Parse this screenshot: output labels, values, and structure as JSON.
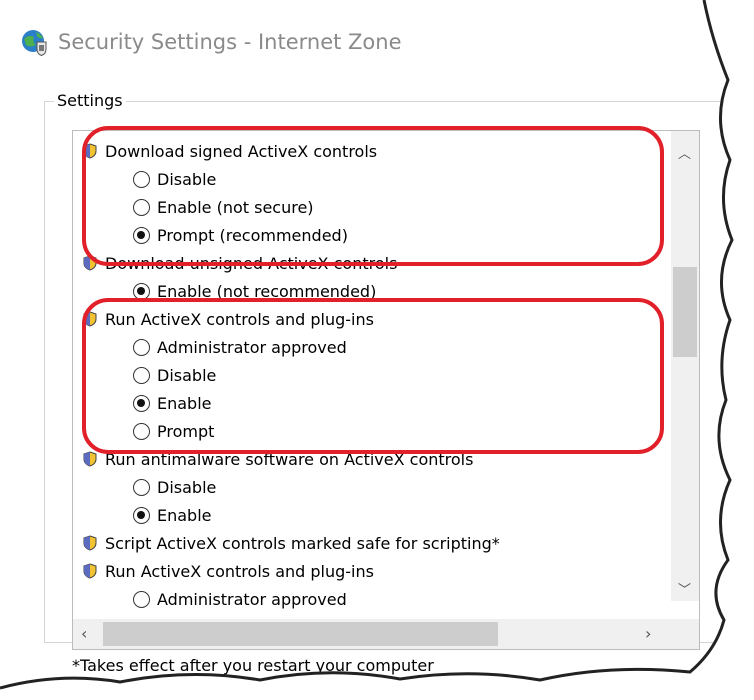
{
  "dialog": {
    "title": "Security Settings - Internet Zone",
    "icon": "globe-shield-icon",
    "group_label": "Settings",
    "footnote": "*Takes effect after you restart your computer"
  },
  "settings": [
    {
      "label": "Download signed ActiveX controls",
      "options": [
        {
          "label": "Disable",
          "selected": false
        },
        {
          "label": "Enable (not secure)",
          "selected": false
        },
        {
          "label": "Prompt (recommended)",
          "selected": true
        }
      ]
    },
    {
      "label": "Download unsigned ActiveX controls",
      "options": [
        {
          "label": "Enable (not recommended)",
          "selected": true
        }
      ]
    },
    {
      "label": "Run ActiveX controls and plug-ins",
      "options": [
        {
          "label": "Administrator approved",
          "selected": false
        },
        {
          "label": "Disable",
          "selected": false
        },
        {
          "label": "Enable",
          "selected": true
        },
        {
          "label": "Prompt",
          "selected": false
        }
      ]
    },
    {
      "label": "Run antimalware software on ActiveX controls",
      "options": [
        {
          "label": "Disable",
          "selected": false
        },
        {
          "label": "Enable",
          "selected": true
        }
      ]
    },
    {
      "label": "Script ActiveX controls marked safe for scripting*",
      "options": []
    },
    {
      "label": "Run ActiveX controls and plug-ins",
      "options": [
        {
          "label": "Administrator approved",
          "selected": false
        }
      ]
    }
  ],
  "highlight_color": "#e2202a",
  "icons": {
    "shield": "shield-icon",
    "scroll_up": "chevron-up-icon",
    "scroll_down": "chevron-down-icon",
    "scroll_left": "chevron-left-icon",
    "scroll_right": "chevron-right-icon"
  }
}
